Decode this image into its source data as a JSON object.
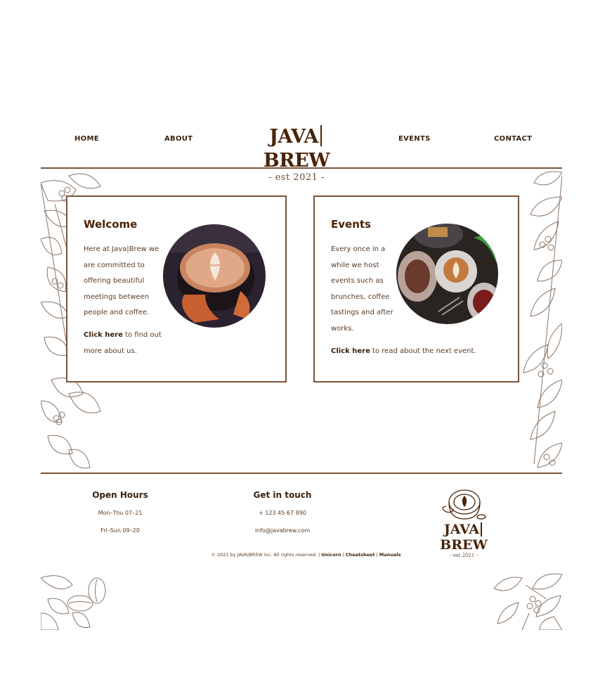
{
  "nav": {
    "home": "HOME",
    "about": "ABOUT",
    "events": "EVENTS",
    "contact": "CONTACT"
  },
  "logo": {
    "left": "JAVA",
    "right": "BREW",
    "tagline": "- est 2021 -"
  },
  "welcome": {
    "title": "Welcome",
    "lines": [
      "Here at Java|Brew we",
      "are committed to",
      "offering beautiful",
      "meetings between",
      "people and coffee."
    ],
    "cta_link": "Click here",
    "cta_rest_1": " to find out",
    "cta_rest_2": "more about us."
  },
  "events": {
    "title": "Events",
    "lines": [
      "Every once in a",
      "while we host",
      "events such as",
      "brunches, coffee",
      "tastings and after",
      "works."
    ],
    "cta_link": "Click here",
    "cta_rest": " to read about the next event."
  },
  "footer": {
    "hours_title": "Open Hours",
    "hours_1": "Mon–Thu 07–21",
    "hours_2": "Fri–Sun 09–20",
    "contact_title": "Get in touch",
    "phone": "+ 123 45 67 890",
    "email": "info@javabrew.com",
    "copyright_text": "© 2021 by JAVA|BREW inc. All rights reserved. | ",
    "link_unicorn": "Unicorn",
    "sep1": " | ",
    "link_cheatsheet": "Cheatsheet",
    "sep2": " | ",
    "link_manuals": "Manuals"
  },
  "colors": {
    "brand_brown": "#4a2408",
    "border_brown": "#7a5236",
    "text_brown": "#5a3a24"
  }
}
